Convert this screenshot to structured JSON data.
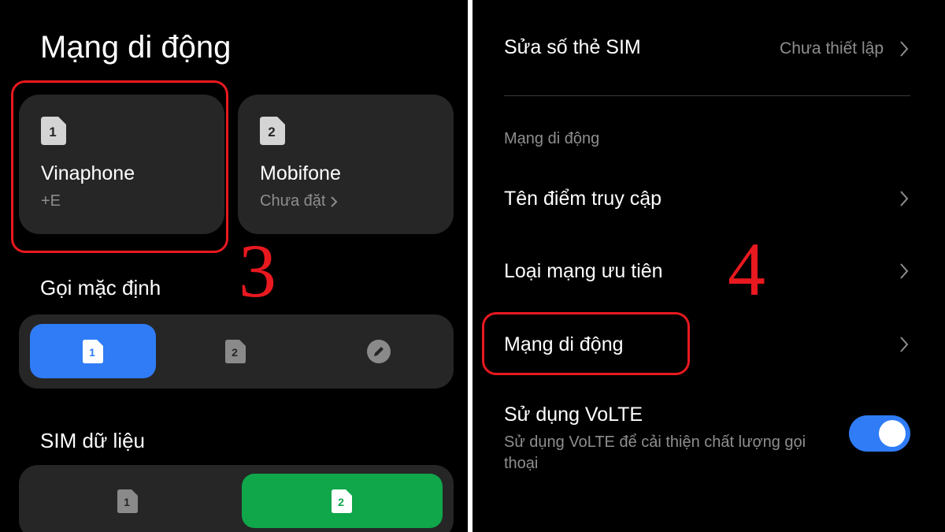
{
  "left": {
    "title": "Mạng di động",
    "sim_cards": [
      {
        "number": "1",
        "name": "Vinaphone",
        "status": "+E"
      },
      {
        "number": "2",
        "name": "Mobifone",
        "status": "Chưa đặt"
      }
    ],
    "default_call": {
      "label": "Gọi mặc định",
      "options": [
        "1",
        "2",
        "edit-icon"
      ],
      "selected": "1"
    },
    "data_sim": {
      "label": "SIM dữ liệu",
      "options": [
        "1",
        "2"
      ],
      "selected": "2"
    }
  },
  "right": {
    "edit_sim_number": {
      "label": "Sửa số thẻ SIM",
      "value": "Chưa thiết lập"
    },
    "section_label": "Mạng di động",
    "rows": [
      {
        "label": "Tên điểm truy cập"
      },
      {
        "label": "Loại mạng ưu tiên"
      },
      {
        "label": "Mạng di động"
      }
    ],
    "volte": {
      "label": "Sử dụng VoLTE",
      "description": "Sử dụng VoLTE để cải thiện chất lượng gọi thoại",
      "enabled": true
    }
  },
  "annotations": {
    "step_left": "3",
    "step_right": "4"
  },
  "colors": {
    "background": "#000000",
    "card": "#262626",
    "accent_blue": "#2f7cf6",
    "accent_green": "#10a64a",
    "highlight_red": "#e8191f",
    "secondary_text": "#8e8e8e"
  }
}
